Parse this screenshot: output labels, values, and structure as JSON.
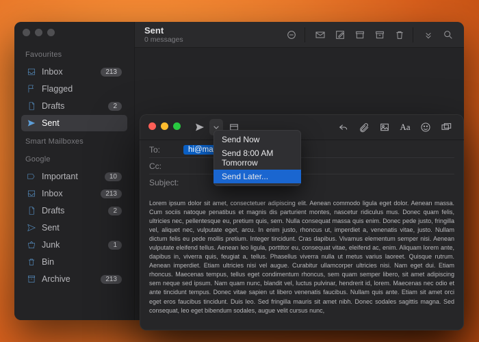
{
  "mainWindow": {
    "title": "Sent",
    "subtitle": "0 messages"
  },
  "sidebar": {
    "favourites_label": "Favourites",
    "smart_label": "Smart Mailboxes",
    "google_label": "Google",
    "fav": [
      {
        "label": "Inbox",
        "badge": "213"
      },
      {
        "label": "Flagged",
        "badge": ""
      },
      {
        "label": "Drafts",
        "badge": "2"
      },
      {
        "label": "Sent",
        "badge": ""
      }
    ],
    "google": [
      {
        "label": "Important",
        "badge": "10"
      },
      {
        "label": "Inbox",
        "badge": "213"
      },
      {
        "label": "Drafts",
        "badge": "2"
      },
      {
        "label": "Sent",
        "badge": ""
      },
      {
        "label": "Junk",
        "badge": "1"
      },
      {
        "label": "Bin",
        "badge": ""
      },
      {
        "label": "Archive",
        "badge": "213"
      }
    ]
  },
  "compose": {
    "to_label": "To:",
    "cc_label": "Cc:",
    "subject_label": "Subject:",
    "to_token": "hi@maketech",
    "body": "Lorem ipsum dolor sit amet, consectetuer adipiscing elit. Aenean commodo ligula eget dolor. Aenean massa. Cum sociis natoque penatibus et magnis dis parturient montes, nascetur ridiculus mus. Donec quam felis, ultricies nec, pellentesque eu, pretium quis, sem. Nulla consequat massa quis enim. Donec pede justo, fringilla vel, aliquet nec, vulputate eget, arcu. In enim justo, rhoncus ut, imperdiet a, venenatis vitae, justo. Nullam dictum felis eu pede mollis pretium. Integer tincidunt. Cras dapibus. Vivamus elementum semper nisi. Aenean vulputate eleifend tellus. Aenean leo ligula, porttitor eu, consequat vitae, eleifend ac, enim. Aliquam lorem ante, dapibus in, viverra quis, feugiat a, tellus. Phasellus viverra nulla ut metus varius laoreet. Quisque rutrum. Aenean imperdiet. Etiam ultricies nisi vel augue. Curabitur ullamcorper ultricies nisi. Nam eget dui. Etiam rhoncus. Maecenas tempus, tellus eget condimentum rhoncus, sem quam semper libero, sit amet adipiscing sem neque sed ipsum. Nam quam nunc, blandit vel, luctus pulvinar, hendrerit id, lorem. Maecenas nec odio et ante tincidunt tempus. Donec vitae sapien ut libero venenatis faucibus. Nullam quis ante. Etiam sit amet orci eget eros faucibus tincidunt. Duis leo. Sed fringilla mauris sit amet nibh. Donec sodales sagittis magna. Sed consequat, leo eget bibendum sodales, augue velit cursus nunc,"
  },
  "dropdown": {
    "items": [
      "Send Now",
      "Send 8:00 AM Tomorrow",
      "Send Later..."
    ]
  }
}
